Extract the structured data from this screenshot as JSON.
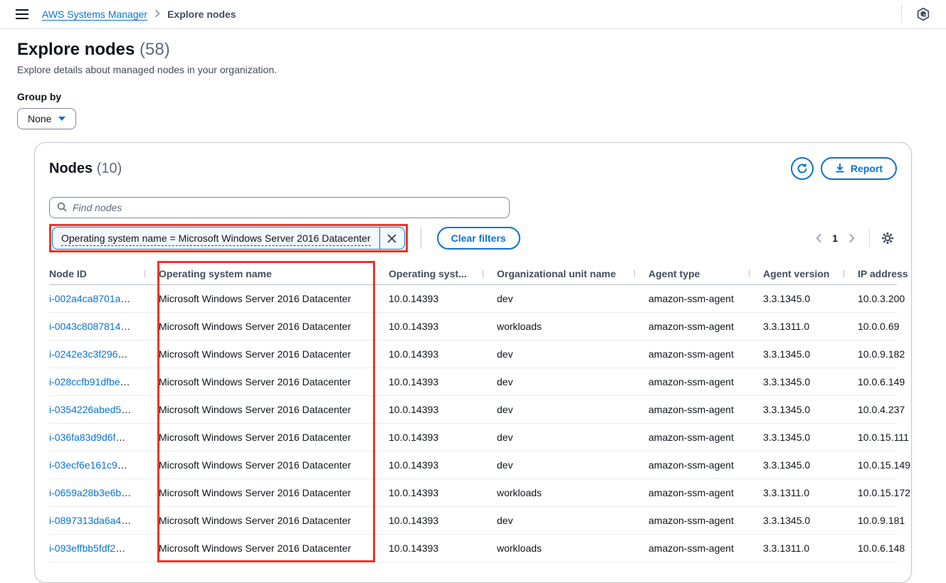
{
  "topbar": {
    "breadcrumb_link": "AWS Systems Manager",
    "breadcrumb_current": "Explore nodes"
  },
  "page": {
    "title": "Explore nodes",
    "count": "(58)",
    "subtitle": "Explore details about managed nodes in your organization.",
    "group_by": {
      "label": "Group by",
      "value": "None"
    }
  },
  "panel": {
    "title": "Nodes",
    "count": "(10)",
    "report_button": "Report",
    "search": {
      "placeholder": "Find nodes"
    },
    "filter_token": {
      "text": "Operating system name = Microsoft Windows Server 2016 Datacenter"
    },
    "clear_filters_button": "Clear filters",
    "pagination": {
      "page": "1"
    }
  },
  "table": {
    "truncation": "…",
    "columns": [
      "Node ID",
      "Operating system name",
      "Operating syst...",
      "Organizational unit name",
      "Agent type",
      "Agent version",
      "IP address"
    ],
    "rows": [
      {
        "node_id": "i-002a4ca8701a",
        "os_name": "Microsoft Windows Server 2016 Datacenter",
        "os_version": "10.0.14393",
        "org_unit": "dev",
        "agent_type": "amazon-ssm-agent",
        "agent_version": "3.3.1345.0",
        "ip": "10.0.3.200"
      },
      {
        "node_id": "i-0043c8087814",
        "os_name": "Microsoft Windows Server 2016 Datacenter",
        "os_version": "10.0.14393",
        "org_unit": "workloads",
        "agent_type": "amazon-ssm-agent",
        "agent_version": "3.3.1311.0",
        "ip": "10.0.0.69"
      },
      {
        "node_id": "i-0242e3c3f296",
        "os_name": "Microsoft Windows Server 2016 Datacenter",
        "os_version": "10.0.14393",
        "org_unit": "dev",
        "agent_type": "amazon-ssm-agent",
        "agent_version": "3.3.1345.0",
        "ip": "10.0.9.182"
      },
      {
        "node_id": "i-028ccfb91dfbe",
        "os_name": "Microsoft Windows Server 2016 Datacenter",
        "os_version": "10.0.14393",
        "org_unit": "dev",
        "agent_type": "amazon-ssm-agent",
        "agent_version": "3.3.1345.0",
        "ip": "10.0.6.149"
      },
      {
        "node_id": "i-0354226abed5",
        "os_name": "Microsoft Windows Server 2016 Datacenter",
        "os_version": "10.0.14393",
        "org_unit": "dev",
        "agent_type": "amazon-ssm-agent",
        "agent_version": "3.3.1345.0",
        "ip": "10.0.4.237"
      },
      {
        "node_id": "i-036fa83d9d6f",
        "os_name": "Microsoft Windows Server 2016 Datacenter",
        "os_version": "10.0.14393",
        "org_unit": "dev",
        "agent_type": "amazon-ssm-agent",
        "agent_version": "3.3.1345.0",
        "ip": "10.0.15.111"
      },
      {
        "node_id": "i-03ecf6e161c9",
        "os_name": "Microsoft Windows Server 2016 Datacenter",
        "os_version": "10.0.14393",
        "org_unit": "dev",
        "agent_type": "amazon-ssm-agent",
        "agent_version": "3.3.1345.0",
        "ip": "10.0.15.149"
      },
      {
        "node_id": "i-0659a28b3e6b",
        "os_name": "Microsoft Windows Server 2016 Datacenter",
        "os_version": "10.0.14393",
        "org_unit": "workloads",
        "agent_type": "amazon-ssm-agent",
        "agent_version": "3.3.1311.0",
        "ip": "10.0.15.172"
      },
      {
        "node_id": "i-0897313da6a4",
        "os_name": "Microsoft Windows Server 2016 Datacenter",
        "os_version": "10.0.14393",
        "org_unit": "dev",
        "agent_type": "amazon-ssm-agent",
        "agent_version": "3.3.1345.0",
        "ip": "10.0.9.181"
      },
      {
        "node_id": "i-093effbb5fdf2",
        "os_name": "Microsoft Windows Server 2016 Datacenter",
        "os_version": "10.0.14393",
        "org_unit": "workloads",
        "agent_type": "amazon-ssm-agent",
        "agent_version": "3.3.1311.0",
        "ip": "10.0.6.148"
      }
    ]
  },
  "colors": {
    "accent": "#0972d3",
    "annotation_red": "#ee3524",
    "text_primary": "#0f141a",
    "text_secondary": "#5f6b7a",
    "token_background": "#f2f8fd"
  }
}
